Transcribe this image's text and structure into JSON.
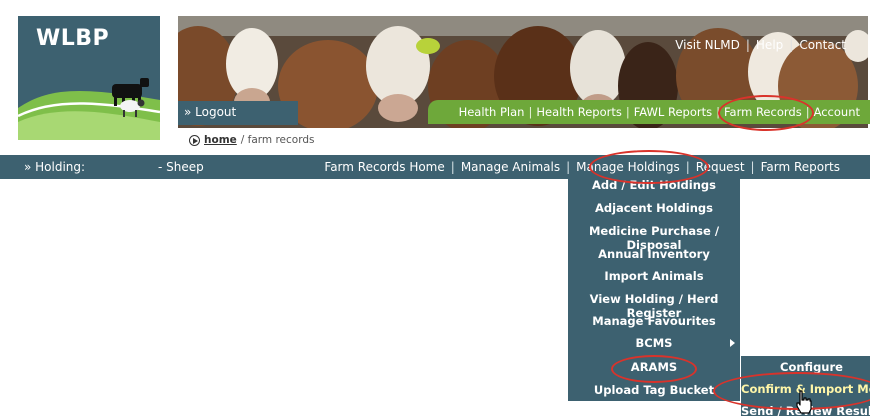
{
  "header": {
    "logo_text": "WLBP",
    "top_links": [
      "Visit NLMD",
      "Help",
      "Contact"
    ],
    "logout_label": "» Logout"
  },
  "green_nav": {
    "items": [
      "Health Plan",
      "Health Reports",
      "FAWL Reports",
      "Farm Records",
      "Account"
    ]
  },
  "breadcrumb": {
    "home": "home",
    "rest": "/ farm records"
  },
  "main_nav": {
    "holding_label": "» Holding:",
    "holding_value": "- Sheep",
    "items": [
      "Farm Records Home",
      "Manage Animals",
      "Manage Holdings",
      "Request",
      "Farm Reports"
    ]
  },
  "dropdown": {
    "items": [
      "Add / Edit Holdings",
      "Adjacent Holdings",
      "Medicine Purchase / Disposal",
      "Annual Inventory",
      "Import Animals",
      "View Holding / Herd Register",
      "Manage Favourites",
      "BCMS",
      "ARAMS",
      "Upload Tag Bucket"
    ]
  },
  "submenu": {
    "items": [
      "Configure",
      "Confirm & Import Movements",
      "Send / Review Results"
    ]
  },
  "colors": {
    "nav_teal": "#3d6170",
    "nav_green": "#6ea83a",
    "highlight_red": "#d9332b",
    "active_yellow": "#fff6a8"
  },
  "icons": {
    "breadcrumb": "circle-arrow-icon",
    "cursor": "hand-pointer-icon",
    "submenu": "chevron-right-icon"
  }
}
